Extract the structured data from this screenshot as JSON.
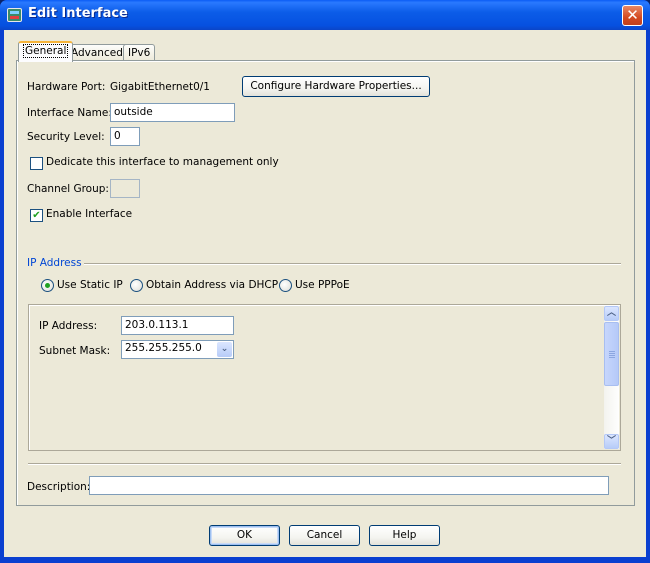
{
  "window": {
    "title": "Edit Interface",
    "icon": "asdm-app-icon",
    "close_glyph": "✕"
  },
  "tabs": [
    {
      "label": "General",
      "active": true
    },
    {
      "label": "Advanced",
      "active": false
    },
    {
      "label": "IPv6",
      "active": false
    }
  ],
  "general": {
    "hardware_port_label": "Hardware Port:",
    "hardware_port_value": "GigabitEthernet0/1",
    "configure_hw_button": "Configure Hardware Properties...",
    "interface_name_label": "Interface Name:",
    "interface_name_value": "outside",
    "security_level_label": "Security Level:",
    "security_level_value": "0",
    "management_only_label": "Dedicate this interface to management only",
    "management_only_checked": false,
    "channel_group_label": "Channel Group:",
    "channel_group_value": "",
    "enable_interface_label": "Enable Interface",
    "enable_interface_checked": true
  },
  "ip_address_section": {
    "title": "IP Address",
    "options": [
      {
        "label": "Use Static IP",
        "selected": true
      },
      {
        "label": "Obtain Address via DHCP",
        "selected": false
      },
      {
        "label": "Use PPPoE",
        "selected": false
      }
    ],
    "ip_address_label": "IP Address:",
    "ip_address_value": "203.0.113.1",
    "subnet_mask_label": "Subnet Mask:",
    "subnet_mask_value": "255.255.255.0"
  },
  "description": {
    "label": "Description:",
    "value": ""
  },
  "buttons": {
    "ok": "OK",
    "cancel": "Cancel",
    "help": "Help"
  },
  "glyphs": {
    "check": "✔",
    "chevron_up": "︿",
    "chevron_down": "﹀",
    "dropdown": "⌄"
  },
  "colors": {
    "titlebar": "#0a5cf5",
    "dialog_bg": "#ece9d8",
    "section_title": "#0046d5",
    "check_green": "#21a121",
    "close_red": "#d44a22"
  }
}
